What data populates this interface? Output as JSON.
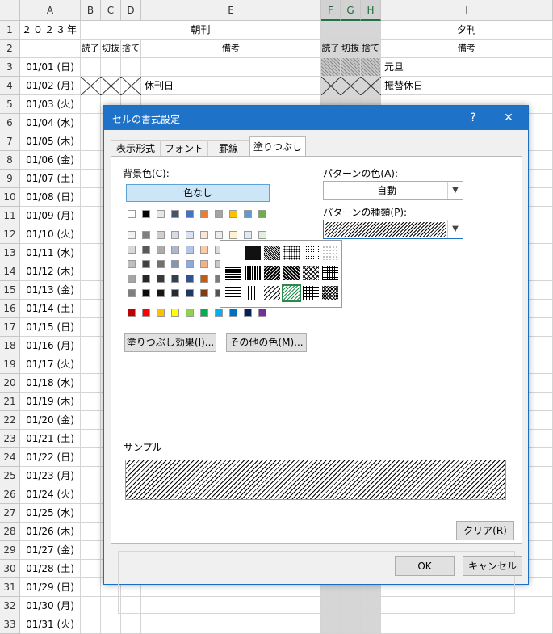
{
  "sheet": {
    "columns": [
      "A",
      "B",
      "C",
      "D",
      "E",
      "F",
      "G",
      "H",
      "I"
    ],
    "rows": [
      "1",
      "2",
      "3",
      "4",
      "5",
      "6",
      "7",
      "8",
      "9",
      "10",
      "11",
      "12",
      "13",
      "14",
      "15",
      "16",
      "17",
      "18",
      "19",
      "20",
      "21",
      "22",
      "23",
      "24",
      "25",
      "26",
      "27",
      "28",
      "29",
      "30",
      "31",
      "32",
      "33"
    ],
    "year_label": "２０２３年",
    "morning_header": "朝刊",
    "evening_header": "夕刊",
    "sub_headers": [
      "読了",
      "切抜",
      "捨て",
      "備考",
      "読了",
      "切抜",
      "捨て",
      "備考"
    ],
    "dates": [
      "01/01 (日)",
      "01/02 (月)",
      "01/03 (火)",
      "01/04 (水)",
      "01/05 (木)",
      "01/06 (金)",
      "01/07 (土)",
      "01/08 (日)",
      "01/09 (月)",
      "01/10 (火)",
      "01/11 (水)",
      "01/12 (木)",
      "01/13 (金)",
      "01/14 (土)",
      "01/15 (日)",
      "01/16 (月)",
      "01/17 (火)",
      "01/18 (水)",
      "01/19 (木)",
      "01/20 (金)",
      "01/21 (土)",
      "01/22 (日)",
      "01/23 (月)",
      "01/24 (火)",
      "01/25 (水)",
      "01/26 (木)",
      "01/27 (金)",
      "01/28 (土)",
      "01/29 (日)",
      "01/30 (月)",
      "01/31 (火)"
    ],
    "remarks_morning_row4": "休刊日",
    "remarks_evening_row3": "元旦",
    "remarks_evening_row4": "振替休日"
  },
  "dialog": {
    "title": "セルの書式設定",
    "help": "?",
    "close": "✕",
    "tabs": [
      "表示形式",
      "フォント",
      "罫線",
      "塗りつぶし"
    ],
    "active_tab": "塗りつぶし",
    "bg_color_label": "背景色(C):",
    "no_color": "色なし",
    "pattern_color_label": "パターンの色(A):",
    "pattern_color_value": "自動",
    "pattern_type_label": "パターンの種類(P):",
    "fill_effects_button": "塗りつぶし効果(I)...",
    "more_colors_button": "その他の色(M)...",
    "sample_label": "サンプル",
    "clear_button": "クリア(R)",
    "ok_button": "OK",
    "cancel_button": "キャンセル",
    "colors": {
      "theme_top": [
        "#ffffff",
        "#000000",
        "#e7e6e6",
        "#44546a",
        "#4472c4",
        "#ed7d31",
        "#a5a5a5",
        "#ffc000",
        "#5b9bd5",
        "#70ad47"
      ],
      "theme_shades": [
        [
          "#f2f2f2",
          "#7f7f7f",
          "#d0cece",
          "#d6dce4",
          "#d9e2f3",
          "#fbe5d5",
          "#ededed",
          "#fff2cc",
          "#deebf6",
          "#e2efd9"
        ],
        [
          "#d8d8d8",
          "#595959",
          "#aeabab",
          "#adb9ca",
          "#b4c6e7",
          "#f7cbac",
          "#dbdbdb",
          "#fee599",
          "#bdd7ee",
          "#c5e0b3"
        ],
        [
          "#bfbfbf",
          "#3f3f3f",
          "#757070",
          "#8496b0",
          "#8eaadb",
          "#f4b183",
          "#c9c9c9",
          "#ffd965",
          "#9cc3e5",
          "#a8d08d"
        ],
        [
          "#a5a5a5",
          "#262626",
          "#3a3838",
          "#323f4f",
          "#2f5496",
          "#c55a11",
          "#7b7b7b",
          "#bf9000",
          "#2e75b5",
          "#538135"
        ],
        [
          "#7f7f7f",
          "#0c0c0c",
          "#171616",
          "#222a35",
          "#1f3864",
          "#833c0b",
          "#525252",
          "#7f6000",
          "#1e4e79",
          "#375623"
        ]
      ],
      "standard": [
        "#c00000",
        "#ff0000",
        "#ffc000",
        "#ffff00",
        "#92d050",
        "#00b050",
        "#00b0f0",
        "#0070c0",
        "#002060",
        "#7030a0"
      ]
    }
  }
}
